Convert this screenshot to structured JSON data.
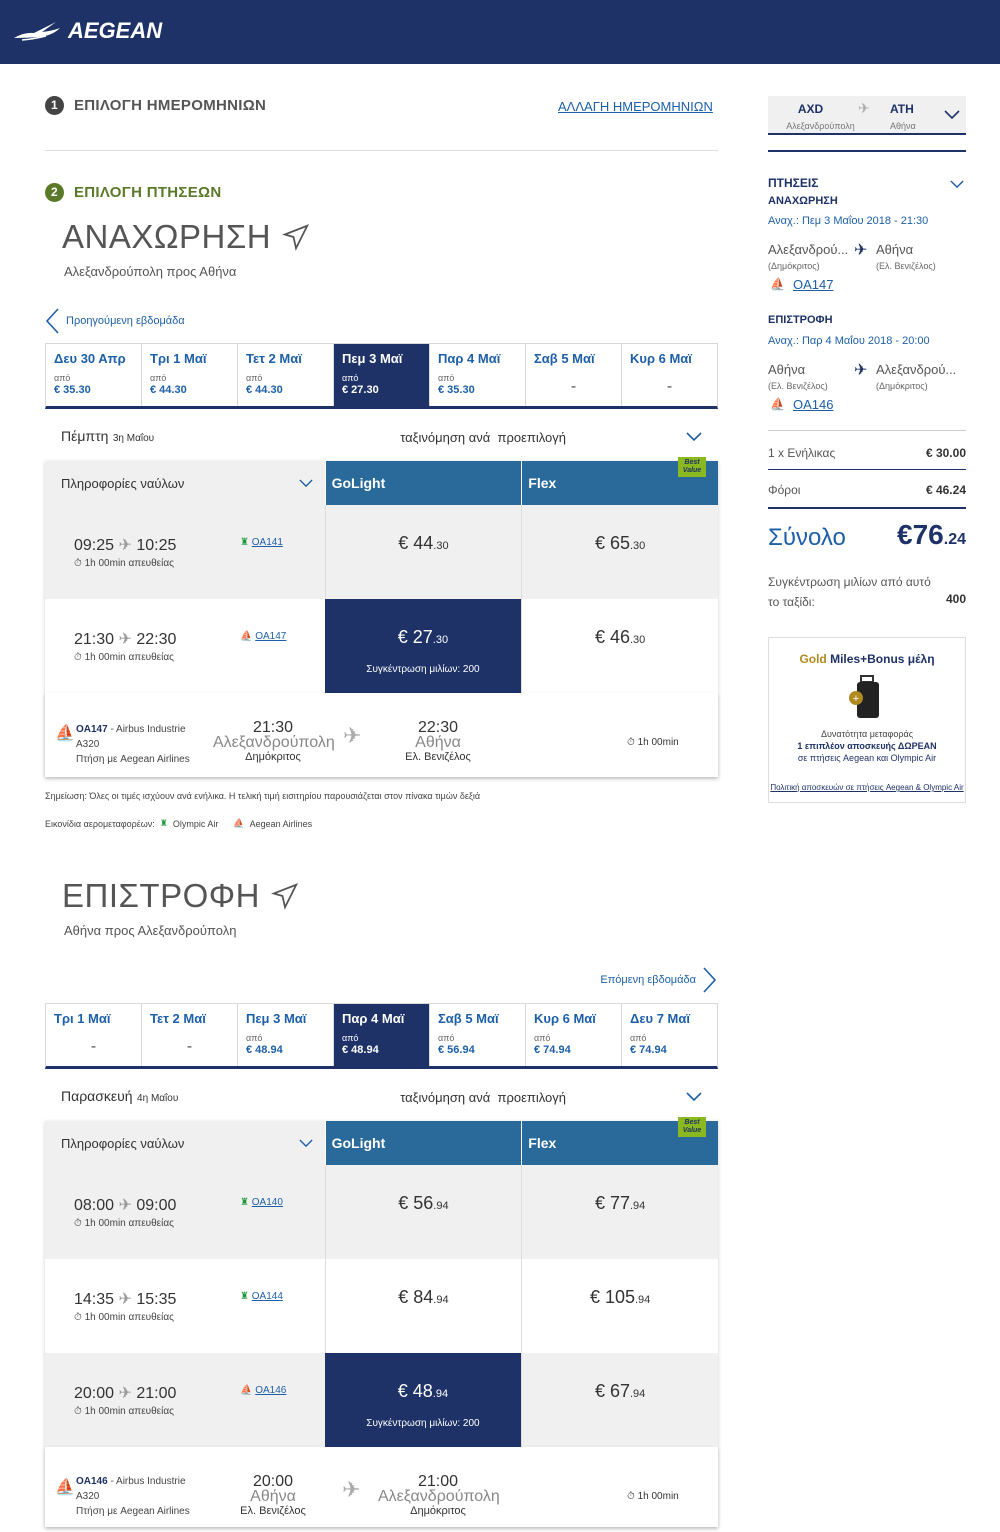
{
  "header": {
    "logo": "AEGEAN"
  },
  "steps": {
    "step1_num": "1",
    "step1": "ΕΠΙΛΟΓΗ ΗΜΕΡΟΜΗΝΙΩΝ",
    "change_dates": "ΑΛΛΑΓΗ ΗΜΕΡΟΜΗΝΙΩΝ",
    "step2_num": "2",
    "step2": "ΕΠΙΛΟΓΗ ΠΤΗΣΕΩΝ"
  },
  "outbound": {
    "title": "ΑΝΑΧΩΡΗΣΗ",
    "subtitle": "Αλεξανδρούπολη προς Αθήνα",
    "prev_week": "Προηγούμενη εβδομάδα",
    "days": [
      {
        "name": "Δευ 30 Απρ",
        "apo": "από",
        "price": "€ 35.30"
      },
      {
        "name": "Τρι 1 Μαϊ",
        "apo": "από",
        "price": "€ 44.30"
      },
      {
        "name": "Τετ 2 Μαϊ",
        "apo": "από",
        "price": "€ 44.30"
      },
      {
        "name": "Πεμ 3 Μαϊ",
        "apo": "από",
        "price": "€ 27.30"
      },
      {
        "name": "Παρ 4 Μαϊ",
        "apo": "από",
        "price": "€ 35.30"
      },
      {
        "name": "Σαβ 5 Μαϊ",
        "apo": "",
        "price": "",
        "dash": "-"
      },
      {
        "name": "Κυρ 6 Μαϊ",
        "apo": "",
        "price": "",
        "dash": "-"
      }
    ],
    "date_label": "Πέμπτη",
    "date_small": "3η Μαΐου",
    "sort_label": "ταξινόμηση ανά",
    "sort_value": "προεπιλογή",
    "fare_info": "Πληροφορίες ναύλων",
    "col1": "GoLight",
    "col2": "Flex",
    "best_value": "Best Value",
    "flights": [
      {
        "dep": "09:25",
        "arr": "10:25",
        "dur": "1h 00min απευθείας",
        "fno": "OA141",
        "p1": "€ 44",
        "p1c": ".30",
        "p2": "€ 65",
        "p2c": ".30"
      },
      {
        "dep": "21:30",
        "arr": "22:30",
        "dur": "1h 00min απευθείας",
        "fno": "OA147",
        "p1": "€ 27",
        "p1c": ".30",
        "p2": "€ 46",
        "p2c": ".30",
        "miles": "Συγκέντρωση μιλίων: 200"
      }
    ],
    "detail": {
      "fno": "OA147",
      "aircraft": " - Airbus Industrie",
      "model": "A320",
      "op": "Πτήση με Aegean Airlines",
      "dep": "21:30",
      "from": "Αλεξανδρούπολη",
      "from_ap": "Δημόκριτος",
      "arr": "22:30",
      "to": "Αθήνα",
      "to_ap": "Ελ. Βενιζέλος",
      "dur": "1h 00min"
    }
  },
  "notes": {
    "note": "Σημείωση: Όλες οι τιμές ισχύουν ανά ενήλικα. Η τελική τιμή εισιτηρίου παρουσιάζεται στον πίνακα τιμών δεξιά",
    "icons_label": "Εικονίδια αερομεταφορέων:",
    "olympic": "Olympic Air",
    "aegean": "Aegean Airlines"
  },
  "inbound": {
    "title": "ΕΠΙΣΤΡΟΦΗ",
    "subtitle": "Αθήνα προς Αλεξανδρούπολη",
    "next_week": "Επόμενη εβδομάδα",
    "days": [
      {
        "name": "Τρι 1 Μαϊ",
        "apo": "",
        "price": "",
        "dash": "-"
      },
      {
        "name": "Τετ 2 Μαϊ",
        "apo": "",
        "price": "",
        "dash": "-"
      },
      {
        "name": "Πεμ 3 Μαϊ",
        "apo": "από",
        "price": "€ 48.94"
      },
      {
        "name": "Παρ 4 Μαϊ",
        "apo": "από",
        "price": "€ 48.94"
      },
      {
        "name": "Σαβ 5 Μαϊ",
        "apo": "από",
        "price": "€ 56.94"
      },
      {
        "name": "Κυρ 6 Μαϊ",
        "apo": "από",
        "price": "€ 74.94"
      },
      {
        "name": "Δευ 7 Μαϊ",
        "apo": "από",
        "price": "€ 74.94"
      }
    ],
    "date_label": "Παρασκευή",
    "date_small": "4η Μαΐου",
    "sort_label": "ταξινόμηση ανά",
    "sort_value": "προεπιλογή",
    "flights": [
      {
        "dep": "08:00",
        "arr": "09:00",
        "dur": "1h 00min απευθείας",
        "fno": "OA140",
        "p1": "€ 56",
        "p1c": ".94",
        "p2": "€ 77",
        "p2c": ".94"
      },
      {
        "dep": "14:35",
        "arr": "15:35",
        "dur": "1h 00min απευθείας",
        "fno": "OA144",
        "p1": "€ 84",
        "p1c": ".94",
        "p2": "€ 105",
        "p2c": ".94"
      },
      {
        "dep": "20:00",
        "arr": "21:00",
        "dur": "1h 00min απευθείας",
        "fno": "OA146",
        "p1": "€ 48",
        "p1c": ".94",
        "p2": "€ 67",
        "p2c": ".94",
        "miles": "Συγκέντρωση μιλίων: 200"
      }
    ],
    "detail": {
      "fno": "OA146",
      "aircraft": " - Airbus Industrie",
      "model": "A320",
      "op": "Πτήση με Aegean Airlines",
      "dep": "20:00",
      "from": "Αθήνα",
      "from_ap": "Ελ. Βενιζέλος",
      "arr": "21:00",
      "to": "Αλεξανδρούπολη",
      "to_ap": "Δημόκριτος",
      "dur": "1h 00min"
    }
  },
  "sidebar": {
    "from_code": "AXD",
    "from_city": "Αλεξανδρούπολη",
    "to_code": "ATH",
    "to_city": "Αθήνα",
    "flights_h": "ΠΤΗΣΕΙΣ",
    "dep_h": "ΑΝΑΧΩΡΗΣΗ",
    "dep_line": "Αναχ.: Πεμ 3 Μαΐου 2018 - 21:30",
    "dep_from": "Αλεξανδρού...",
    "dep_from_ap": "(Δημόκριτος)",
    "dep_to": "Αθήνα",
    "dep_to_ap": "(Ελ. Βενιζέλος)",
    "dep_fno": "OA147",
    "ret_h": "ΕΠΙΣΤΡΟΦΗ",
    "ret_line": "Αναχ.: Παρ 4 Μαΐου 2018 - 20:00",
    "ret_from": "Αθήνα",
    "ret_from_ap": "(Ελ. Βενιζέλος)",
    "ret_to": "Αλεξανδρού...",
    "ret_to_ap": "(Δημόκριτος)",
    "ret_fno": "OA146",
    "adult": "1 x Ενήλικας",
    "adult_price": "€ 30.00",
    "taxes": "Φόροι",
    "taxes_price": "€ 46.24",
    "total": "Σύνολο",
    "total_price": "€76",
    "total_cents": ".24",
    "miles_text": "Συγκέντρωση μιλίων από αυτό το ταξίδι:",
    "miles_val": "400",
    "promo_gold": "Gold",
    "promo_title": " Miles+Bonus μέλη",
    "promo_l1": "Δυνατότητα μεταφοράς",
    "promo_l2": "1 επιπλέον αποσκευής ΔΩΡΕΑΝ",
    "promo_l3": "σε πτήσεις Aegean και Olympic Air",
    "promo_link": "Πολιτική αποσκευών σε πτήσεις Aegean & Olympic Air"
  },
  "colors": {
    "navy": "#1e3267",
    "blue": "#2a6a9b",
    "link": "#1d5fa8",
    "green": "#5a7a2a",
    "badge": "#8ab81f"
  }
}
